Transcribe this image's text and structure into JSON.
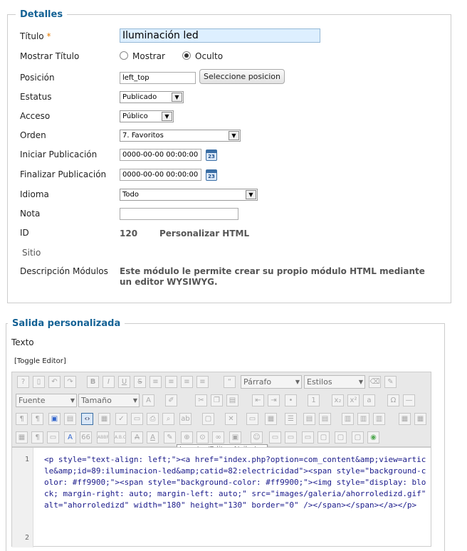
{
  "details": {
    "legend": "Detalles",
    "titulo_label": "Título",
    "titulo_value": "Iluminación led",
    "mostrar_titulo_label": "Mostrar Título",
    "mostrar_label": "Mostrar",
    "oculto_label": "Oculto",
    "posicion_label": "Posición",
    "posicion_value": "left_top",
    "posicion_button": "Seleccione posicion",
    "estatus_label": "Estatus",
    "estatus_value": "Publicado",
    "acceso_label": "Acceso",
    "acceso_value": "Público",
    "orden_label": "Orden",
    "orden_value": "7. Favoritos",
    "iniciar_label": "Iniciar Publicación",
    "iniciar_value": "0000-00-00 00:00:00",
    "finalizar_label": "Finalizar Publicación",
    "finalizar_value": "0000-00-00 00:00:00",
    "idioma_label": "Idioma",
    "idioma_value": "Todo",
    "nota_label": "Nota",
    "nota_value": "",
    "id_label": "ID",
    "id_value": "120",
    "module_type": "Personalizar HTML",
    "sitio_label": "Sitio",
    "descripcion_label": "Descripción Módulos",
    "descripcion_value": "Este módulo le permite crear su propio módulo HTML mediante un editor WYSIWYG.",
    "calendar_number": "23"
  },
  "output": {
    "legend": "Salida personalizada",
    "texto_label": "Texto",
    "toggle_editor": "[Toggle Editor]",
    "toolbar": {
      "format_select": "Párrafo",
      "styles_select": "Estilos",
      "font_select": "Fuente",
      "size_select": "Tamaño"
    },
    "tooltip": "Insertar/Editar Atributos",
    "code_lines": [
      "<p style=\"text-align: left;\"><a href=\"index.php?option=com_content&amp;view=article&amp;id=89:iluminacion-led&amp;catid=82:electricidad\"><span style=\"background-color: #ff9900;\"><span style=\"background-color: #ff9900;\"><img style=\"display: block; margin-right: auto; margin-left: auto;\" src=\"images/galeria/ahorroledizd.gif\" alt=\"ahorroledizd\" width=\"180\" height=\"130\" border=\"0\" /></span></span></a></p>"
    ],
    "line_numbers": [
      "1",
      "2"
    ]
  },
  "colors": {
    "legend_blue": "#146295",
    "required_orange": "#e57b00",
    "title_input_bg": "#ddefff"
  }
}
